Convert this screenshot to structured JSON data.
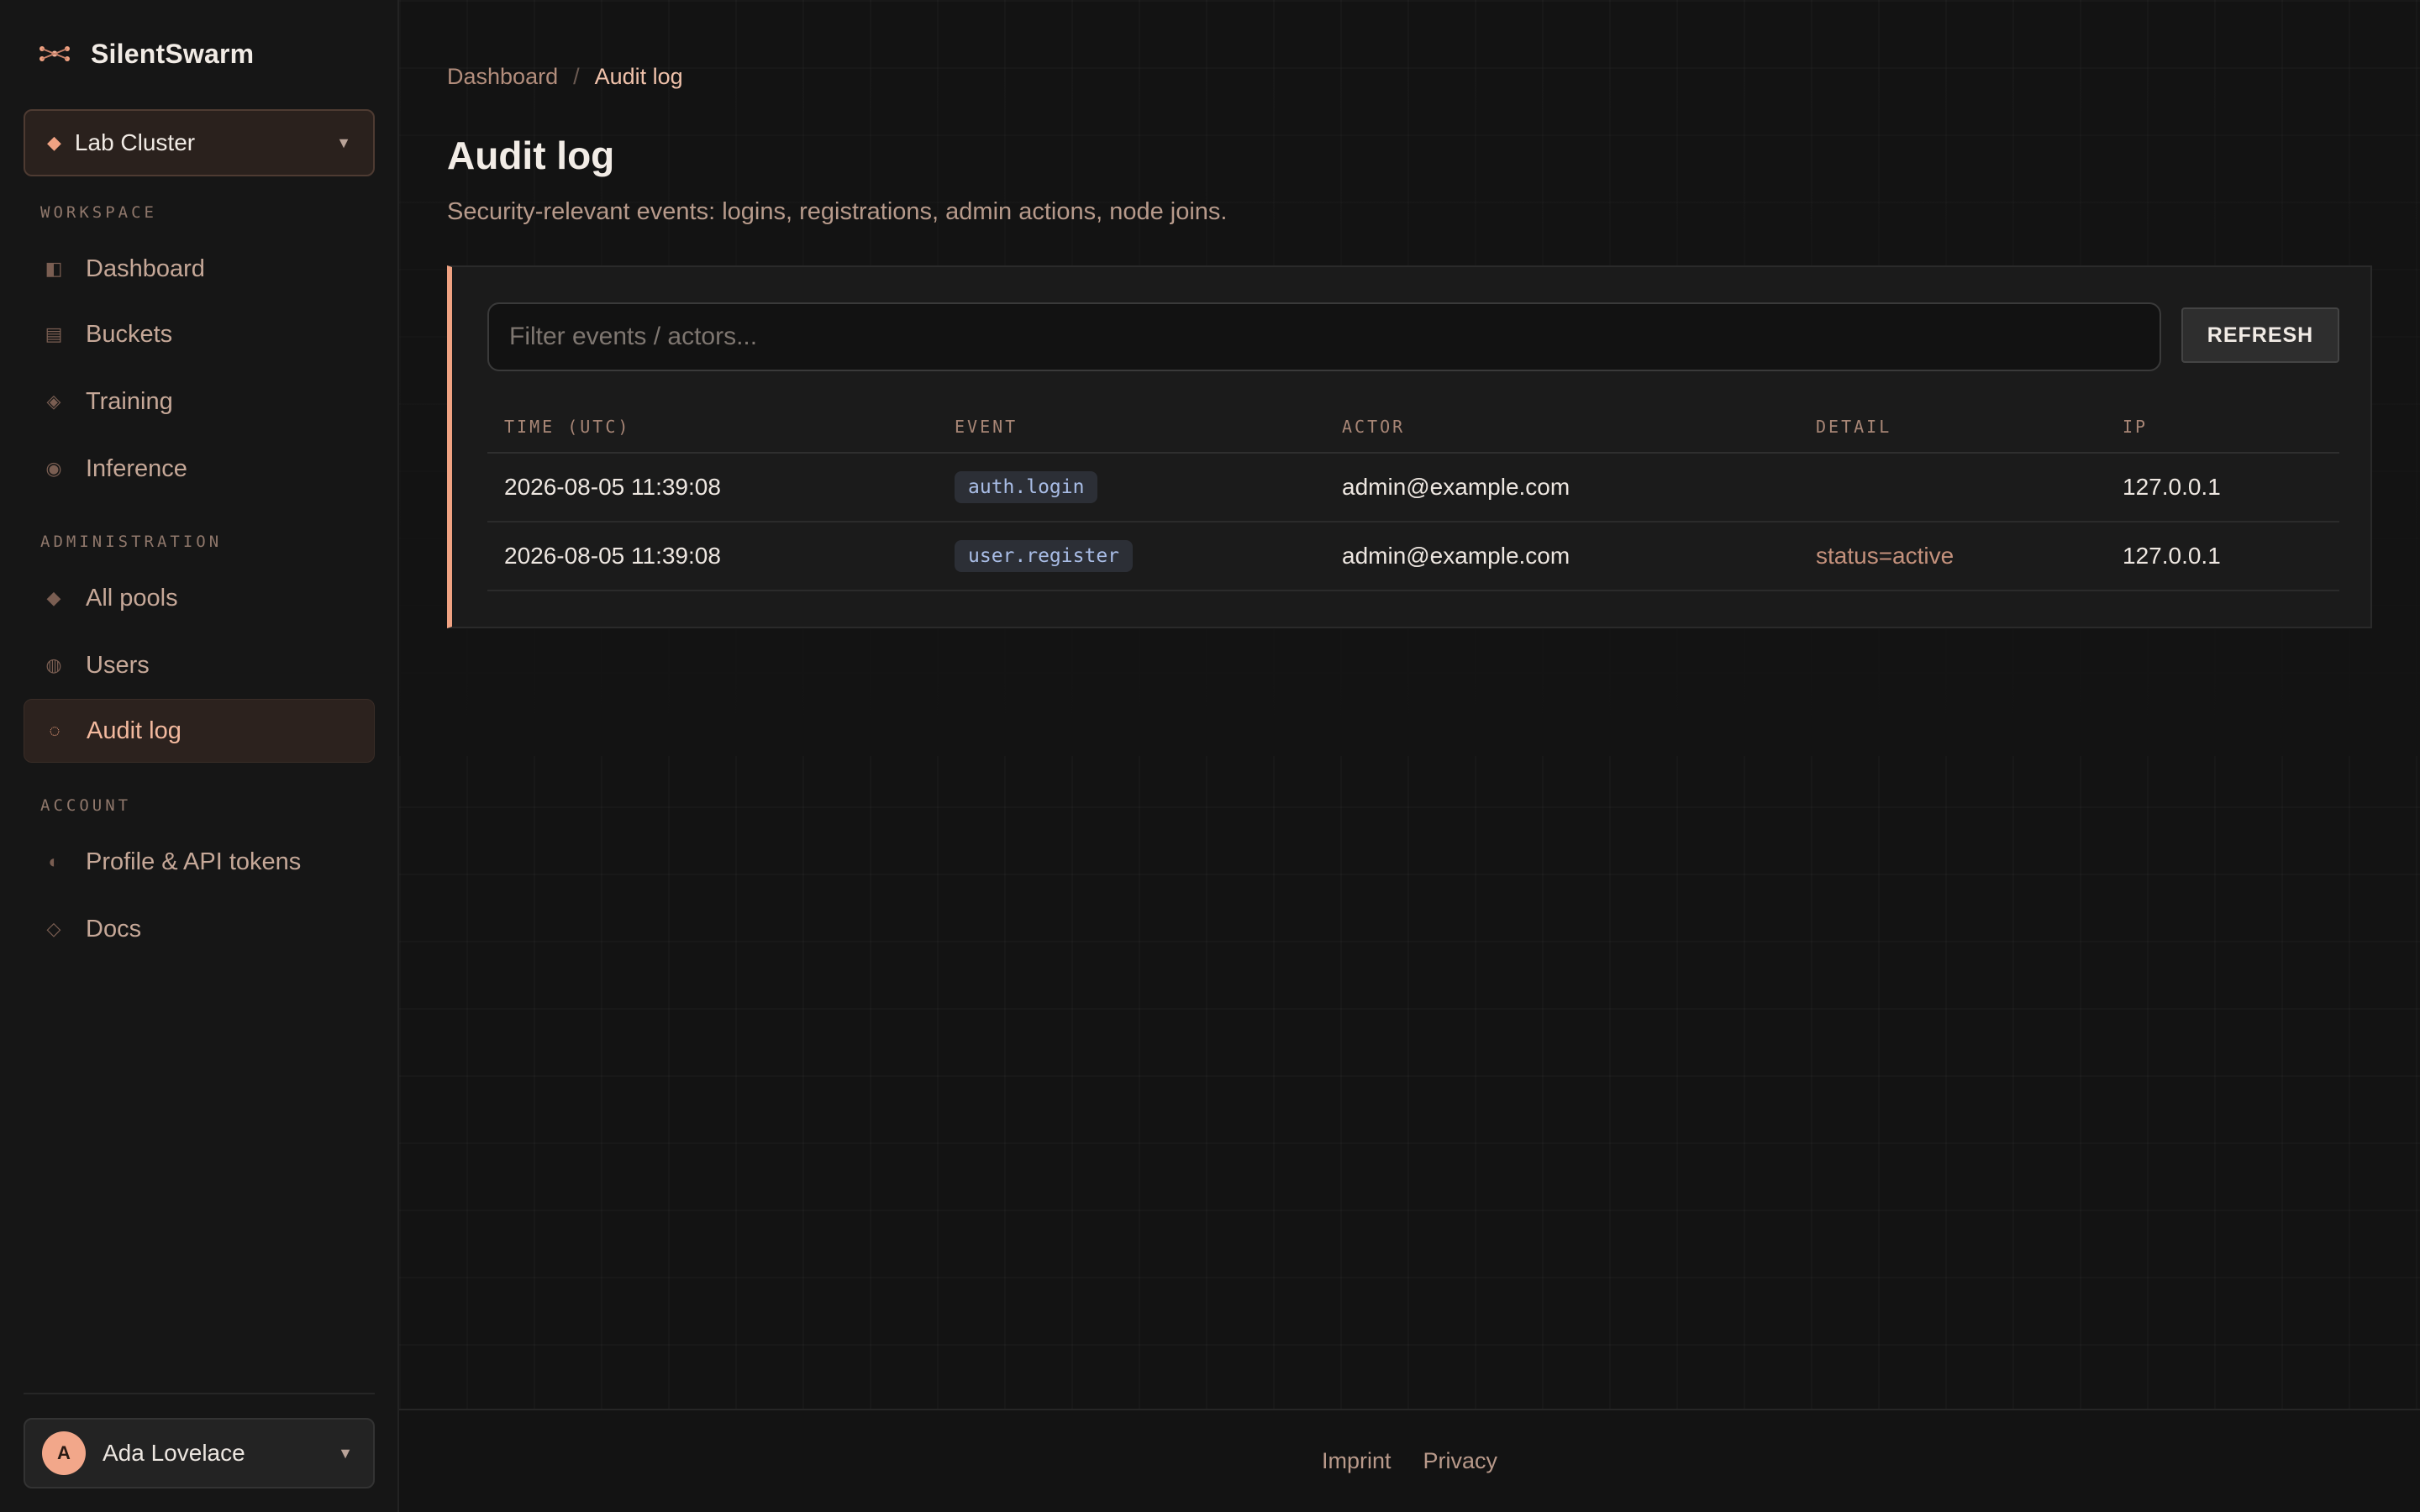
{
  "app": {
    "name": "SilentSwarm"
  },
  "cluster": {
    "name": "Lab Cluster"
  },
  "sidebar": {
    "sections": {
      "workspace": "WORKSPACE",
      "administration": "ADMINISTRATION",
      "account": "ACCOUNT"
    },
    "items": [
      {
        "label": "Dashboard",
        "icon": "dashboard-icon"
      },
      {
        "label": "Buckets",
        "icon": "buckets-icon"
      },
      {
        "label": "Training",
        "icon": "training-icon"
      },
      {
        "label": "Inference",
        "icon": "inference-icon"
      },
      {
        "label": "All pools",
        "icon": "pools-icon"
      },
      {
        "label": "Users",
        "icon": "users-icon"
      },
      {
        "label": "Audit log",
        "icon": "audit-icon",
        "active": true
      },
      {
        "label": "Profile & API tokens",
        "icon": "profile-icon"
      },
      {
        "label": "Docs",
        "icon": "docs-icon"
      }
    ]
  },
  "user": {
    "initial": "A",
    "name": "Ada Lovelace"
  },
  "breadcrumb": {
    "parent": "Dashboard",
    "separator": "/",
    "current": "Audit log"
  },
  "page": {
    "title": "Audit log",
    "subtitle": "Security-relevant events: logins, registrations, admin actions, node joins."
  },
  "filter": {
    "placeholder": "Filter events / actors...",
    "value": ""
  },
  "refresh_label": "REFRESH",
  "table": {
    "headers": [
      "TIME (UTC)",
      "EVENT",
      "ACTOR",
      "DETAIL",
      "IP"
    ],
    "rows": [
      {
        "time": "2026-08-05 11:39:08",
        "event": "auth.login",
        "actor": "admin@example.com",
        "detail": "",
        "ip": "127.0.0.1"
      },
      {
        "time": "2026-08-05 11:39:08",
        "event": "user.register",
        "actor": "admin@example.com",
        "detail": "status=active",
        "ip": "127.0.0.1"
      }
    ]
  },
  "footer": {
    "imprint": "Imprint",
    "privacy": "Privacy"
  },
  "colors": {
    "accent": "#f0a282",
    "background": "#121212",
    "sidebar": "#161616"
  }
}
